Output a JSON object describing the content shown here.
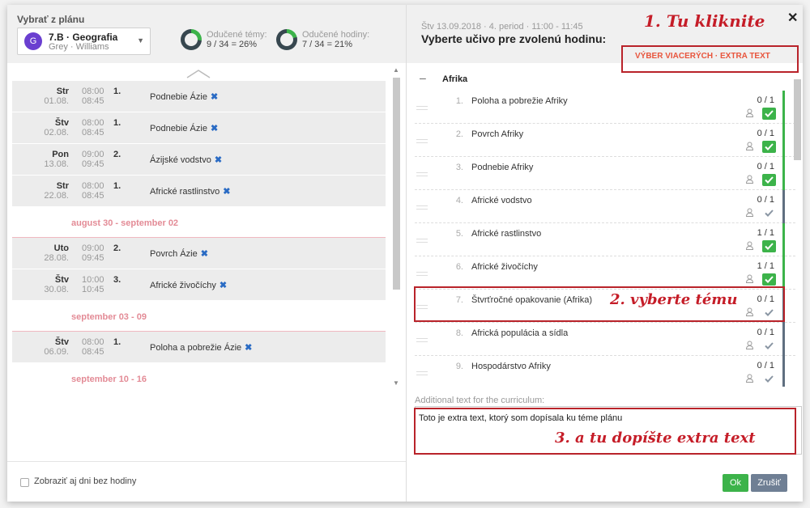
{
  "colors": {
    "accent_green": "#3cb34a",
    "accent_red": "#c51d28",
    "cancel_gray": "#6f7f94",
    "week_pink": "#e38b96",
    "bar_slate": "#5f6f80"
  },
  "left": {
    "plan_label": "Vybrať z plánu",
    "class_select": {
      "avatar_letter": "G",
      "name": "7.B · Geografia",
      "teachers": "Grey · Williams"
    },
    "stats": {
      "topics": {
        "label": "Odučené témy:",
        "value": "9 / 34 = 26%",
        "fraction": 0.26
      },
      "hours": {
        "label": "Odučené hodiny:",
        "value": "7 / 34 = 21%",
        "fraction": 0.21
      }
    },
    "rows": [
      {
        "type": "lesson",
        "day": "Str",
        "date": "01.08.",
        "start": "08:00",
        "end": "08:45",
        "period": "1.",
        "topic": "Podnebie Ázie"
      },
      {
        "type": "lesson",
        "day": "Štv",
        "date": "02.08.",
        "start": "08:00",
        "end": "08:45",
        "period": "1.",
        "topic": "Podnebie Ázie"
      },
      {
        "type": "lesson",
        "day": "Pon",
        "date": "13.08.",
        "start": "09:00",
        "end": "09:45",
        "period": "2.",
        "topic": "Ázijské vodstvo"
      },
      {
        "type": "lesson",
        "day": "Str",
        "date": "22.08.",
        "start": "08:00",
        "end": "08:45",
        "period": "1.",
        "topic": "Africké rastlinstvo"
      },
      {
        "type": "week",
        "label": "august 30 - september 02",
        "divided": true
      },
      {
        "type": "lesson",
        "day": "Uto",
        "date": "28.08.",
        "start": "09:00",
        "end": "09:45",
        "period": "2.",
        "topic": "Povrch Ázie"
      },
      {
        "type": "lesson",
        "day": "Štv",
        "date": "30.08.",
        "start": "10:00",
        "end": "10:45",
        "period": "3.",
        "topic": "Africké živočíchy"
      },
      {
        "type": "week",
        "label": "september 03 - 09",
        "divided": true
      },
      {
        "type": "lesson",
        "day": "Štv",
        "date": "06.09.",
        "start": "08:00",
        "end": "08:45",
        "period": "1.",
        "topic": "Poloha a pobrežie Ázie"
      },
      {
        "type": "week",
        "label": "september 10 - 16",
        "divided": false
      }
    ],
    "show_days_label": "Zobraziť aj dni bez hodiny"
  },
  "right": {
    "meta": "Štv 13.09.2018 · 4. period · 11:00 - 11:45",
    "title": "Vyberte učivo pre zvolenú hodinu:",
    "multi_select": "VÝBER VIACERÝCH · EXTRA TEXT",
    "group": {
      "collapse": "–",
      "name": "Afrika"
    },
    "topics": [
      {
        "num": "1.",
        "name": "Poloha a pobrežie Afriky",
        "count": "0 / 1",
        "checked": true
      },
      {
        "num": "2.",
        "name": "Povrch Afriky",
        "count": "0 / 1",
        "checked": true
      },
      {
        "num": "3.",
        "name": "Podnebie Afriky",
        "count": "0 / 1",
        "checked": true
      },
      {
        "num": "4.",
        "name": "Africké vodstvo",
        "count": "0 / 1",
        "checked": false
      },
      {
        "num": "5.",
        "name": "Africké rastlinstvo",
        "count": "1 / 1",
        "checked": true
      },
      {
        "num": "6.",
        "name": "Africké živočíchy",
        "count": "1 / 1",
        "checked": true
      },
      {
        "num": "7.",
        "name": "Štvrťročné opakovanie (Afrika)",
        "count": "0 / 1",
        "checked": false
      },
      {
        "num": "8.",
        "name": "Africká populácia a sídla",
        "count": "0 / 1",
        "checked": false
      },
      {
        "num": "9.",
        "name": "Hospodárstvo Afriky",
        "count": "0 / 1",
        "checked": false
      }
    ],
    "extra_label": "Additional text for the curriculum:",
    "extra_value": "Toto je extra text, ktorý som dopísala ku téme plánu",
    "ok_label": "Ok",
    "cancel_label": "Zrušiť",
    "close_icon": "close-icon"
  },
  "annotations": {
    "step1": "1. Tu kliknite",
    "step2": "2. vyberte tému",
    "step3": "3. a tu dopíšte extra text"
  }
}
